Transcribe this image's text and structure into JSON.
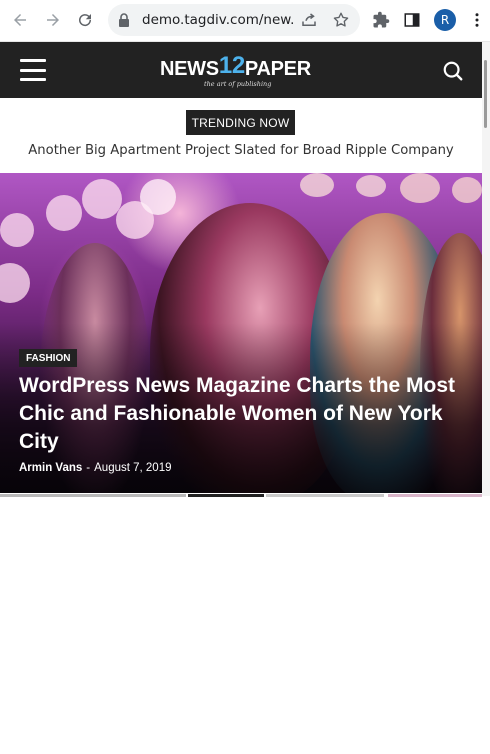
{
  "browser": {
    "url": "demo.tagdiv.com/new...",
    "profile_initial": "R"
  },
  "site": {
    "logo_left": "NEWS",
    "logo_number": "12",
    "logo_right": "PAPER",
    "tagline": "the art of publishing"
  },
  "trending": {
    "label": "TRENDING NOW",
    "headline": "Another Big Apartment Project Slated for Broad Ripple Company"
  },
  "featured": {
    "category": "FASHION",
    "title": "WordPress News Magazine Charts the Most Chic and Fashionable Women of New York City",
    "author": "Armin Vans",
    "separator": "-",
    "date": "August 7, 2019"
  }
}
